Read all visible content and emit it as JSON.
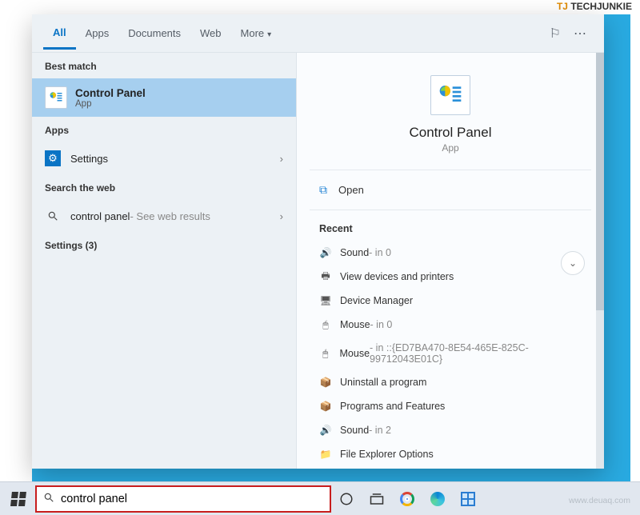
{
  "watermarks": {
    "techjunkie": "TECHJUNKIE",
    "url": "www.deuaq.com"
  },
  "tabs": {
    "all": "All",
    "apps": "Apps",
    "documents": "Documents",
    "web": "Web",
    "more": "More"
  },
  "left": {
    "best_match_hdr": "Best match",
    "best_match": {
      "title": "Control Panel",
      "subtitle": "App"
    },
    "apps_hdr": "Apps",
    "settings_label": "Settings",
    "web_hdr": "Search the web",
    "web_item": {
      "query": "control panel",
      "suffix": " - See web results"
    },
    "settings_count": "Settings (3)"
  },
  "preview": {
    "title": "Control Panel",
    "subtitle": "App",
    "open": "Open",
    "recent_hdr": "Recent",
    "recent": [
      {
        "label": "Sound",
        "suffix": " - in 0",
        "icon": "speaker"
      },
      {
        "label": "View devices and printers",
        "suffix": "",
        "icon": "printer"
      },
      {
        "label": "Device Manager",
        "suffix": "",
        "icon": "device"
      },
      {
        "label": "Mouse",
        "suffix": " - in 0",
        "icon": "mouse"
      },
      {
        "label": "Mouse",
        "suffix": " - in ::{ED7BA470-8E54-465E-825C-99712043E01C}",
        "icon": "mouse"
      },
      {
        "label": "Uninstall a program",
        "suffix": "",
        "icon": "box"
      },
      {
        "label": "Programs and Features",
        "suffix": "",
        "icon": "box"
      },
      {
        "label": "Sound",
        "suffix": " - in 2",
        "icon": "speaker"
      },
      {
        "label": "File Explorer Options",
        "suffix": "",
        "icon": "folder"
      }
    ]
  },
  "search": {
    "value": "control panel"
  }
}
